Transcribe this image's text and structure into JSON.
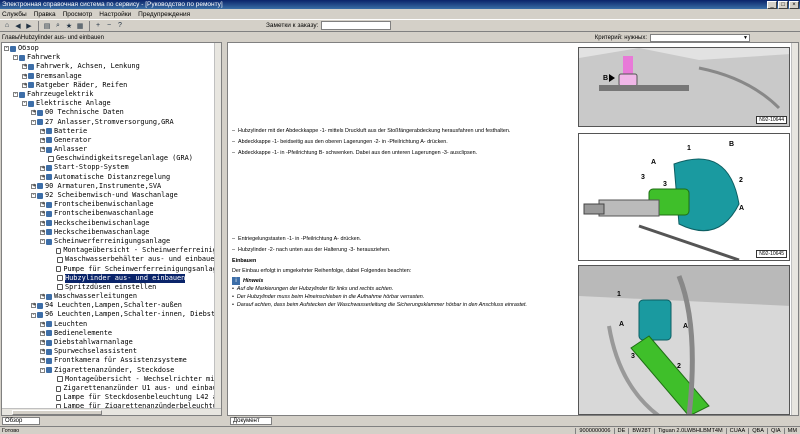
{
  "window": {
    "title": "Электронная справочная система по сервису - [Руководство по ремонту]"
  },
  "menu": [
    "Службы",
    "Правка",
    "Просмотр",
    "Настройки",
    "Предупреждения"
  ],
  "toolbar": {
    "bookmark_label": "Заметки к заказу:"
  },
  "breadcrumb": {
    "path": "Главы\\Hubzylinder aus- und einbauen",
    "criteria_label": "Критерий: нужных:"
  },
  "tree": [
    {
      "indent": 0,
      "tg": "-",
      "icon": "book",
      "label": "Обзор"
    },
    {
      "indent": 1,
      "tg": "-",
      "icon": "book",
      "label": "Fahrwerk"
    },
    {
      "indent": 2,
      "tg": "+",
      "icon": "book",
      "label": "Fahrwerk, Achsen, Lenkung"
    },
    {
      "indent": 2,
      "tg": "+",
      "icon": "book",
      "label": "Bremsanlage"
    },
    {
      "indent": 2,
      "tg": "+",
      "icon": "book",
      "label": "Ratgeber Räder, Reifen"
    },
    {
      "indent": 1,
      "tg": "-",
      "icon": "book",
      "label": "Fahrzeugelektrik"
    },
    {
      "indent": 2,
      "tg": "-",
      "icon": "book",
      "label": "Elektrische Anlage"
    },
    {
      "indent": 3,
      "tg": "+",
      "icon": "book",
      "label": "00 Technische Daten"
    },
    {
      "indent": 3,
      "tg": "-",
      "icon": "book",
      "label": "27 Anlasser,Stromversorgung,GRA"
    },
    {
      "indent": 4,
      "tg": "+",
      "icon": "book",
      "label": "Batterie"
    },
    {
      "indent": 4,
      "tg": "+",
      "icon": "book",
      "label": "Generator"
    },
    {
      "indent": 4,
      "tg": "+",
      "icon": "book",
      "label": "Anlasser"
    },
    {
      "indent": 4,
      "tg": "",
      "icon": "page",
      "label": "Geschwindigkeitsregelanlage (GRA)"
    },
    {
      "indent": 4,
      "tg": "+",
      "icon": "book",
      "label": "Start-Stopp-System"
    },
    {
      "indent": 4,
      "tg": "+",
      "icon": "book",
      "label": "Automatische Distanzregelung"
    },
    {
      "indent": 3,
      "tg": "+",
      "icon": "book",
      "label": "90 Armaturen,Instrumente,SVA"
    },
    {
      "indent": 3,
      "tg": "-",
      "icon": "book",
      "label": "92 Scheibenwisch-und Waschanlage"
    },
    {
      "indent": 4,
      "tg": "+",
      "icon": "book",
      "label": "Frontscheibenwischanlage"
    },
    {
      "indent": 4,
      "tg": "+",
      "icon": "book",
      "label": "Frontscheibenwaschanlage"
    },
    {
      "indent": 4,
      "tg": "+",
      "icon": "book",
      "label": "Heckscheibenwischanlage"
    },
    {
      "indent": 4,
      "tg": "+",
      "icon": "book",
      "label": "Heckscheibenwaschanlage"
    },
    {
      "indent": 4,
      "tg": "-",
      "icon": "book",
      "label": "Scheinwerferreinigungsanlage"
    },
    {
      "indent": 5,
      "tg": "",
      "icon": "page",
      "label": "Montageübersicht - Scheinwerferreinigu"
    },
    {
      "indent": 5,
      "tg": "",
      "icon": "page",
      "label": "Waschwasserbehälter aus- und einbauen"
    },
    {
      "indent": 5,
      "tg": "",
      "icon": "page",
      "label": "Pumpe für Scheinwerferreinigungsanlage"
    },
    {
      "indent": 5,
      "tg": "",
      "icon": "page",
      "label": "Hubzylinder aus- und einbauen",
      "selected": true
    },
    {
      "indent": 5,
      "tg": "",
      "icon": "page",
      "label": "Spritzdüsen einstellen"
    },
    {
      "indent": 4,
      "tg": "+",
      "icon": "book",
      "label": "Waschwasserleitungen"
    },
    {
      "indent": 3,
      "tg": "+",
      "icon": "book",
      "label": "94 Leuchten,Lampen,Schalter-außen"
    },
    {
      "indent": 3,
      "tg": "-",
      "icon": "book",
      "label": "96 Leuchten,Lampen,Schalter-innen, Diebsta"
    },
    {
      "indent": 4,
      "tg": "+",
      "icon": "book",
      "label": "Leuchten"
    },
    {
      "indent": 4,
      "tg": "+",
      "icon": "book",
      "label": "Bedienelemente"
    },
    {
      "indent": 4,
      "tg": "+",
      "icon": "book",
      "label": "Diebstahlwarnanlage"
    },
    {
      "indent": 4,
      "tg": "+",
      "icon": "book",
      "label": "Spurwechselassistent"
    },
    {
      "indent": 4,
      "tg": "+",
      "icon": "book",
      "label": "Frontkamera für Assistenzsysteme"
    },
    {
      "indent": 4,
      "tg": "-",
      "icon": "book",
      "label": "Zigarettenanzünder, Steckdose"
    },
    {
      "indent": 5,
      "tg": "",
      "icon": "page",
      "label": "Montageübersicht - Wechselrichter mit"
    },
    {
      "indent": 5,
      "tg": "",
      "icon": "page",
      "label": "Zigarettenanzünder U1 aus- und einbaue"
    },
    {
      "indent": 5,
      "tg": "",
      "icon": "page",
      "label": "Lampe für Steckdosenbeleuchtung L42 au"
    },
    {
      "indent": 5,
      "tg": "",
      "icon": "page",
      "label": "Lampe für Zigarettenanzünderbeleuchtun"
    }
  ],
  "tabs": {
    "left": "Обзор",
    "right": "Документ"
  },
  "doc": {
    "steps1": [
      "Hubzylinder mit der Abdeckkappe -1- mittels Druckluft aus der Stoßfängerabdeckung herausfahren und festhalten.",
      "Abdeckkappe -1- beidseitig aus den oberen Lagerungen -2- in -Pfeilrichtung A- drücken.",
      "Abdeckkappe -1- in -Pfeilrichtung B- schwenken. Dabei aus den unteren Lagerungen -3- ausclipsen."
    ],
    "steps2": [
      "Entriegelungstasten -1- in -Pfeilrichtung A- drücken.",
      "Hubzylinder -2- nach unten aus der Halterung -3- herausziehen."
    ],
    "einbauen_title": "Einbauen",
    "einbauen_text": "Der Einbau erfolgt in umgekehrter Reihenfolge, dabei Folgendes beachten:",
    "hinweis_title": "Hinweis",
    "hinweis_items": [
      "Auf die Markierungen der Hubzylinder für links und rechts achten.",
      "Der Hubzylinder muss beim Hineinschieben in die Aufnahme hörbar verrasten.",
      "Darauf achten, dass beim Aufstecken der Waschwasserleitung die Sicherungsklammer hörbar in den Anschluss einrastet."
    ]
  },
  "figures": [
    {
      "label": "N92-10644"
    },
    {
      "label": "N92-10645"
    }
  ],
  "status": {
    "ready": "Готово",
    "c1": "9000000006",
    "c2": "DE",
    "c3": "BW28T",
    "c4": "Tiguan 2.0LWBHLBMT4M",
    "c5": "CUAA",
    "c6": "QBA",
    "c7": "QIA",
    "c8": "MM"
  },
  "colors": {
    "selected": "#0a246a",
    "accent_teal": "#1a9aa0",
    "accent_green": "#3fbf2a"
  }
}
